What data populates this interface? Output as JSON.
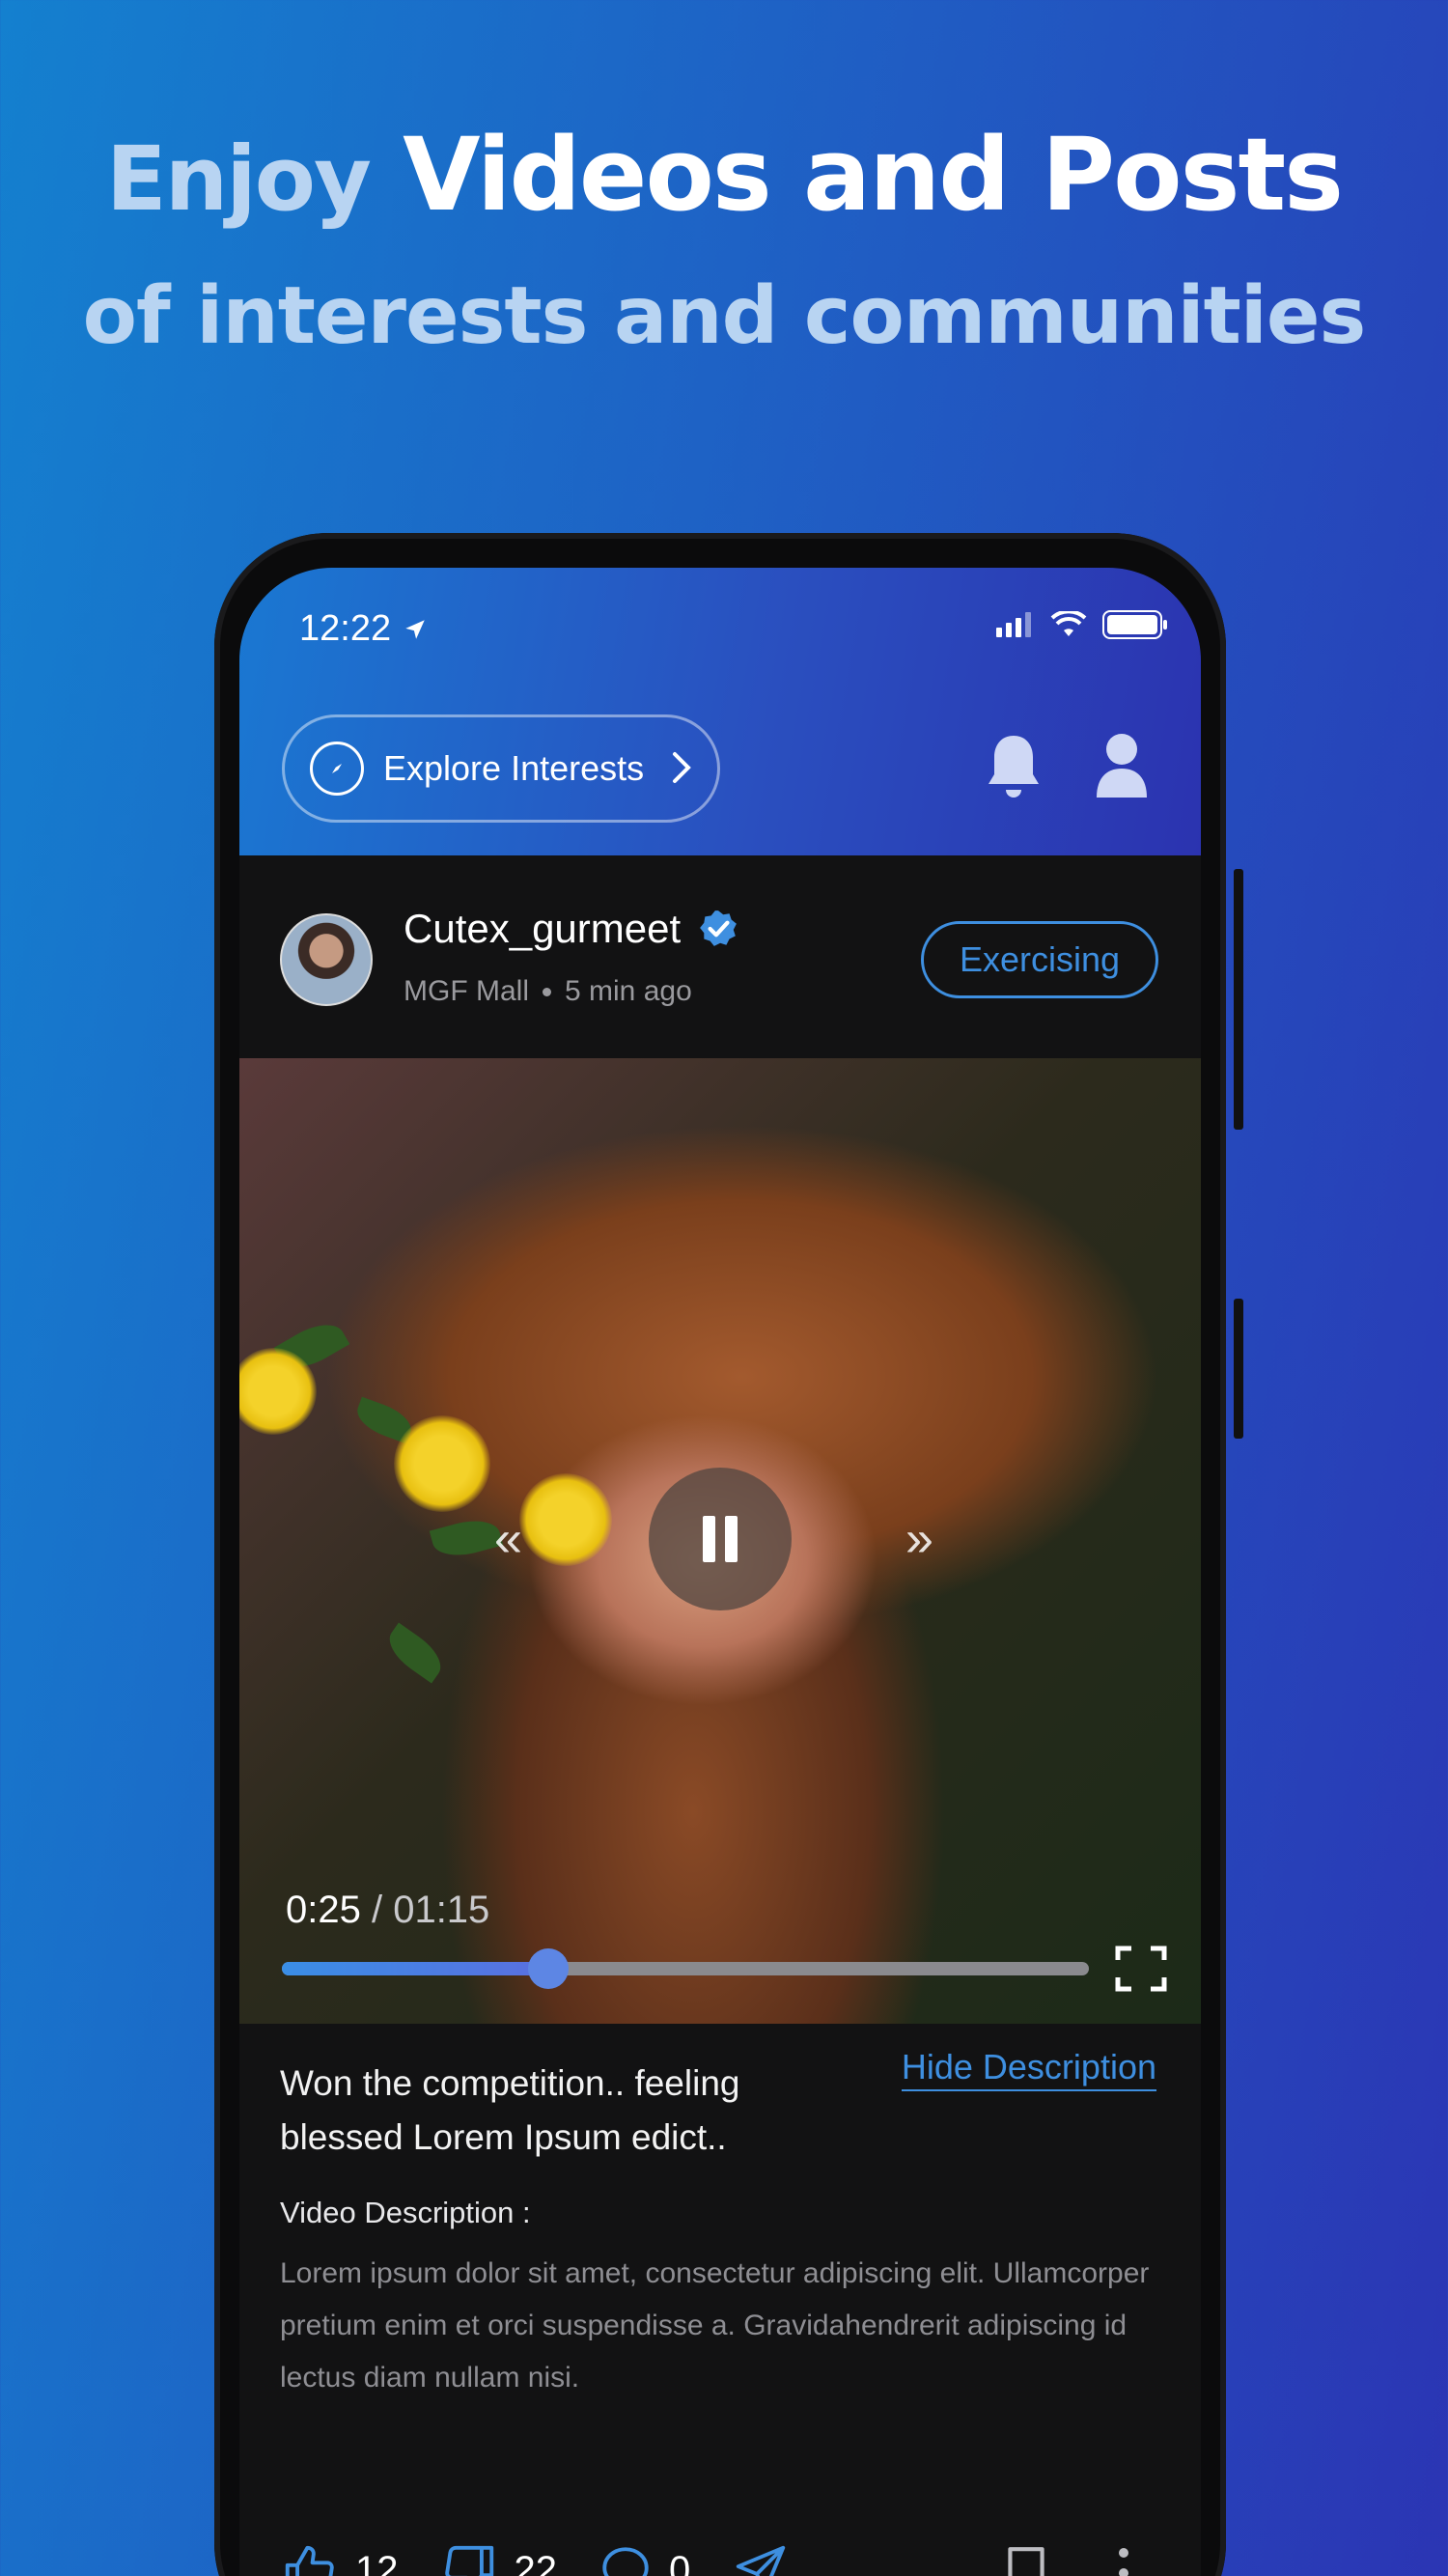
{
  "promo": {
    "headline_light": "Enjoy",
    "headline_bold": "Videos and Posts",
    "subheadline": "of interests and communities"
  },
  "status_bar": {
    "time": "12:22"
  },
  "app_bar": {
    "explore_label": "Explore Interests"
  },
  "post": {
    "username": "Cutex_gurmeet",
    "location": "MGF Mall",
    "time_ago": "5 min ago",
    "interest_tag": "Exercising",
    "video": {
      "current_time": "0:25",
      "separator": " / ",
      "duration": "01:15",
      "progress_fraction": 0.33
    },
    "caption": "Won the competition.. feeling blessed Lorem Ipsum edict..",
    "hide_description_label": "Hide Description",
    "description_title": "Video Description :",
    "description_body": "Lorem ipsum dolor sit amet, consectetur adipiscing elit. Ullamcorper pretium enim et orci suspendisse a. Gravidahendrerit adipiscing id lectus diam nullam nisi.",
    "likes": "12",
    "dislikes": "22",
    "comments": "0"
  },
  "colors": {
    "accent": "#3e8fe0",
    "background_dark": "#121213"
  }
}
